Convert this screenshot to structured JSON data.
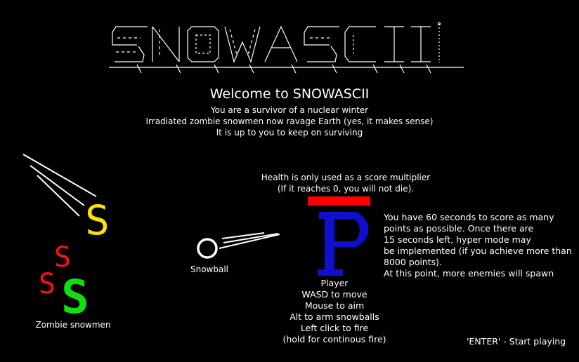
{
  "game": {
    "logo_text": "SNOWASCII",
    "welcome": "Welcome to SNOWASCII",
    "intro_lines": [
      "You are a survivor of a nuclear winter",
      "Irradiated zombie snowmen now ravage Earth (yes, it makes sense)",
      "It is up to you to keep on surviving"
    ],
    "health_note": [
      "Health is only used as a score multiplier",
      "(If it reaches 0, you will not die)."
    ],
    "health_fraction": 1.0,
    "hyper_mode_lines": [
      "You have 60 seconds to score as many",
      "points as possible. Once there are",
      "15 seconds left, hyper mode may",
      "be implemented (if you achieve more than",
      "8000 points).",
      "At this point, more enemies will spawn"
    ],
    "player_glyph": "P",
    "player_caption": [
      "Player",
      "WASD to move",
      "Mouse to aim",
      "Alt to arm snowballs",
      "Left click to fire",
      "(hold for continous fire)"
    ],
    "snowball_glyph": "O",
    "snowball_label": "Snowball",
    "zombie_glyph": "S",
    "zombies_label": "Zombie snowmen",
    "enter_hint": "'ENTER' - Start playing"
  },
  "colors": {
    "background": "#000000",
    "text": "#ffffff",
    "health_bar": "#ff0000",
    "player": "#1010cc",
    "zombie_yellow": "#ffe000",
    "zombie_red": "#ff1010",
    "zombie_green": "#10e010"
  }
}
